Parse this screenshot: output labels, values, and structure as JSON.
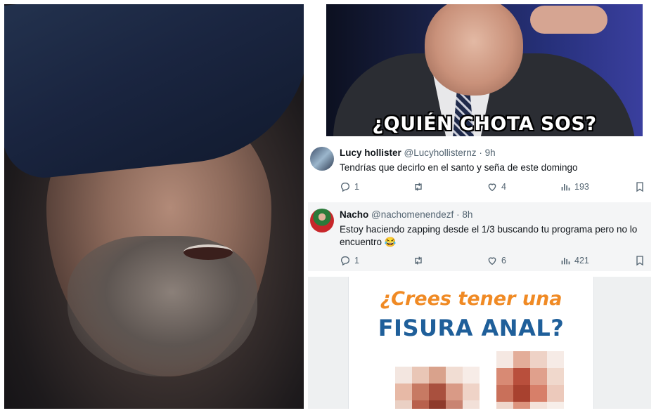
{
  "meme": {
    "caption": "¿QUIÉN CHOTA SOS?"
  },
  "tweets": [
    {
      "display_name": "Lucy hollister",
      "handle": "@Lucyhollisternz",
      "separator": "·",
      "time": "9h",
      "text": "Tendrías que decirlo en el santo y seña de este domingo",
      "replies": "1",
      "retweets": "",
      "likes": "4",
      "views": "193"
    },
    {
      "display_name": "Nacho",
      "handle": "@nachomenendezf",
      "separator": "·",
      "time": "8h",
      "text": "Estoy haciendo zapping desde el 1/3 buscando tu programa pero no lo encuentro 😂",
      "replies": "1",
      "retweets": "",
      "likes": "6",
      "views": "421"
    }
  ],
  "ad": {
    "line1": "¿Crees tener una",
    "line2": "FISURA ANAL?"
  },
  "colors": {
    "ad_orange": "#f08a24",
    "ad_blue": "#1f5f9a",
    "text_secondary": "#536471"
  },
  "icons": [
    "reply-icon",
    "retweet-icon",
    "like-icon",
    "views-icon",
    "bookmark-icon"
  ]
}
